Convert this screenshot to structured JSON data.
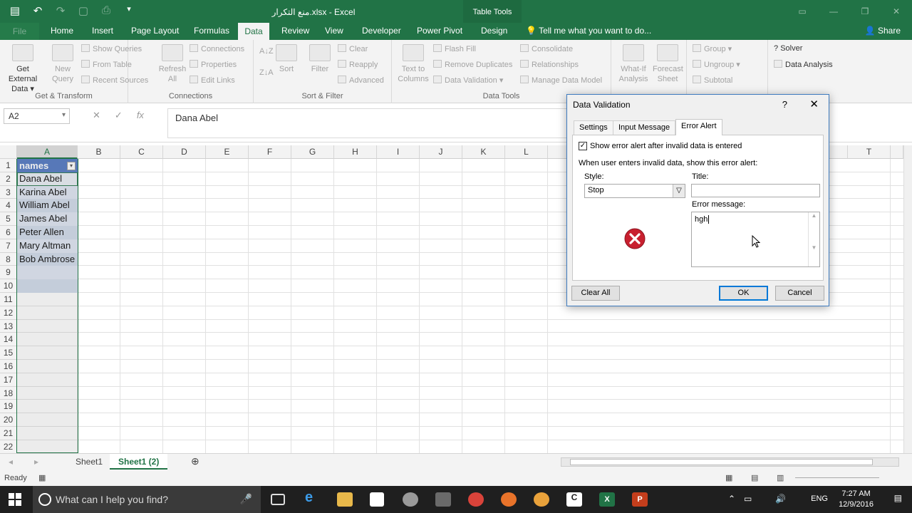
{
  "window": {
    "title": "منع التكرار.xlsx - Excel",
    "context_tab": "Table Tools"
  },
  "ribbon_tabs": [
    "File",
    "Home",
    "Insert",
    "Page Layout",
    "Formulas",
    "Data",
    "Review",
    "View",
    "Developer",
    "Power Pivot",
    "Design"
  ],
  "tell_me": "Tell me what you want to do...",
  "share": "Share",
  "ribbon": {
    "get_transform": {
      "get_external_data": "Get External Data",
      "new_query": "New Query",
      "show_queries": "Show Queries",
      "from_table": "From Table",
      "recent_sources": "Recent Sources",
      "label": "Get & Transform"
    },
    "connections": {
      "refresh_all": "Refresh All",
      "connections": "Connections",
      "properties": "Properties",
      "edit_links": "Edit Links",
      "label": "Connections"
    },
    "sort_filter": {
      "sort": "Sort",
      "filter": "Filter",
      "clear": "Clear",
      "reapply": "Reapply",
      "advanced": "Advanced",
      "label": "Sort & Filter"
    },
    "data_tools": {
      "text_to_columns": "Text to Columns",
      "flash_fill": "Flash Fill",
      "remove_duplicates": "Remove Duplicates",
      "data_validation": "Data Validation",
      "consolidate": "Consolidate",
      "relationships": "Relationships",
      "manage_data_model": "Manage Data Model",
      "label": "Data Tools"
    },
    "forecast": {
      "what_if": "What-If Analysis",
      "forecast_sheet": "Forecast Sheet"
    },
    "outline": {
      "group": "Group",
      "ungroup": "Ungroup",
      "subtotal": "Subtotal"
    },
    "analysis": {
      "solver": "Solver",
      "data_analysis": "Data Analysis"
    }
  },
  "formula_bar": {
    "name_box": "A2",
    "value": "Dana Abel"
  },
  "grid": {
    "columns": [
      "A",
      "B",
      "C",
      "D",
      "E",
      "F",
      "G",
      "H",
      "I",
      "J",
      "K",
      "L",
      "T"
    ],
    "rows": [
      "1",
      "2",
      "3",
      "4",
      "5",
      "6",
      "7",
      "8",
      "9",
      "10",
      "11",
      "12",
      "13",
      "14",
      "15",
      "16",
      "17",
      "18",
      "19",
      "20",
      "21",
      "22"
    ],
    "table_header": "names",
    "names": [
      "Dana Abel",
      "Karina Abel",
      "William Abel",
      "James Abel",
      "Peter Allen",
      "Mary Altman",
      "Bob Ambrose"
    ]
  },
  "sheet_tabs": [
    "Sheet1",
    "Sheet1 (2)"
  ],
  "status": "Ready",
  "dialog": {
    "title": "Data Validation",
    "help": "?",
    "tabs": [
      "Settings",
      "Input Message",
      "Error Alert"
    ],
    "show_alert_label": "Show error alert after invalid data is entered",
    "when_label": "When user enters invalid data, show this error alert:",
    "style_label": "Style:",
    "style_value": "Stop",
    "title_label": "Title:",
    "title_value": "",
    "message_label": "Error message:",
    "message_value": "hgh",
    "clear_all": "Clear All",
    "ok": "OK",
    "cancel": "Cancel"
  },
  "taskbar": {
    "search_placeholder": "What can I help you find?",
    "lang": "ENG",
    "time": "7:27 AM",
    "date": "12/9/2016"
  },
  "colors": {
    "excel_green": "#217346",
    "table_header_blue": "#4a72c0",
    "table_band": "#cfd9ea",
    "stop_red": "#c8202f"
  }
}
